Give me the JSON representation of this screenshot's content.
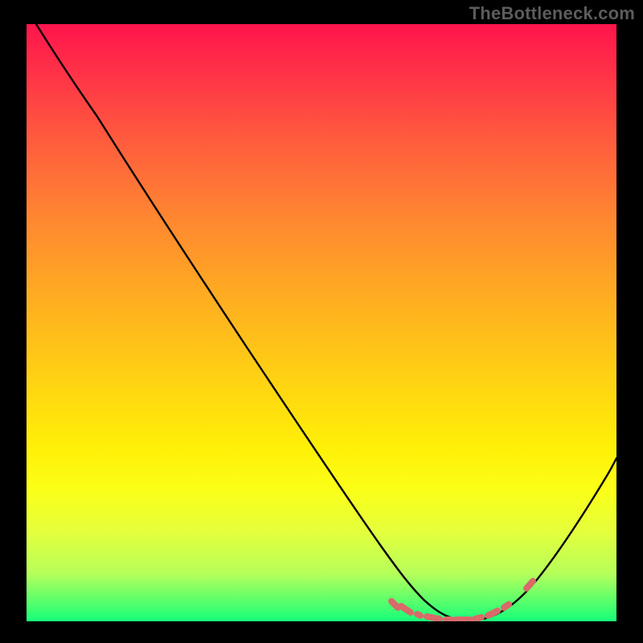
{
  "watermark": "TheBottleneck.com",
  "chart_data": {
    "type": "line",
    "title": "",
    "xlabel": "",
    "ylabel": "",
    "xlim": [
      0,
      100
    ],
    "ylim": [
      0,
      100
    ],
    "grid": false,
    "legend": false,
    "series": [
      {
        "name": "bottleneck-curve",
        "x": [
          2,
          7,
          12,
          18,
          24,
          30,
          36,
          42,
          48,
          54,
          59,
          63,
          66,
          69,
          72,
          75,
          78,
          81,
          83,
          86,
          89,
          92,
          95,
          98,
          100
        ],
        "y": [
          100,
          95,
          89,
          82,
          74,
          66,
          58,
          50,
          42,
          34,
          26,
          19,
          13,
          8,
          4,
          2,
          1,
          1,
          2,
          4,
          8,
          14,
          21,
          29,
          35
        ]
      }
    ],
    "annotations": [
      {
        "name": "optimal-range-marker",
        "type": "dash-band",
        "x_start": 63,
        "x_end": 88,
        "y": 2
      }
    ],
    "background": {
      "type": "vertical-gradient",
      "stops": [
        {
          "pos": 0.0,
          "color": "#ff154c"
        },
        {
          "pos": 0.5,
          "color": "#ffc518"
        },
        {
          "pos": 0.82,
          "color": "#f5ff25"
        },
        {
          "pos": 1.0,
          "color": "#16ff79"
        }
      ]
    }
  }
}
